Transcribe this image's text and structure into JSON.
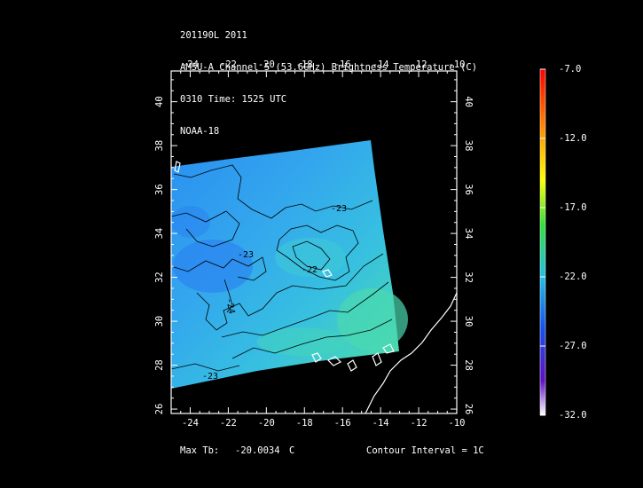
{
  "header": {
    "line1": "201190L 2011",
    "line2": "AMSU-A Channel 5 (53.6GHz) Brightness Temperature (C)",
    "line3": "0310 Time: 1525 UTC",
    "line4": "NOAA-18"
  },
  "map": {
    "x_ticks": [
      "-24",
      "-22",
      "-20",
      "-18",
      "-16",
      "-14",
      "-12",
      "-10"
    ],
    "y_ticks": [
      "26",
      "28",
      "30",
      "32",
      "34",
      "36",
      "38",
      "40"
    ],
    "contour_labels": [
      "-23",
      "-23",
      "-22",
      "-24",
      "-23"
    ],
    "colors": {
      "swath_low": "#2a8ff0",
      "swath_mid": "#35b8e8",
      "swath_high": "#47e0a8",
      "coast": "#ffffff",
      "contour": "#000000"
    }
  },
  "colorbar": {
    "labels": [
      "-7.0",
      "-12.0",
      "-17.0",
      "-22.0",
      "-27.0",
      "-32.0"
    ],
    "min": -32.0,
    "max": -7.0
  },
  "footer": {
    "max_tb_label": "Max Tb:",
    "max_tb_value": "-20.0034",
    "max_tb_unit": "C",
    "contour_interval": "Contour Interval = 1C"
  }
}
